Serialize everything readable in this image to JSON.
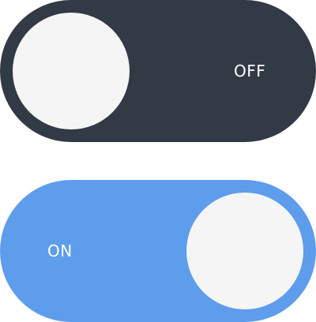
{
  "toggles": {
    "off": {
      "label": "OFF",
      "state": false,
      "track_color": "#323a45",
      "knob_color": "#f5f5f5"
    },
    "on": {
      "label": "ON",
      "state": true,
      "track_color": "#5e9cec",
      "knob_color": "#f5f5f5"
    }
  }
}
